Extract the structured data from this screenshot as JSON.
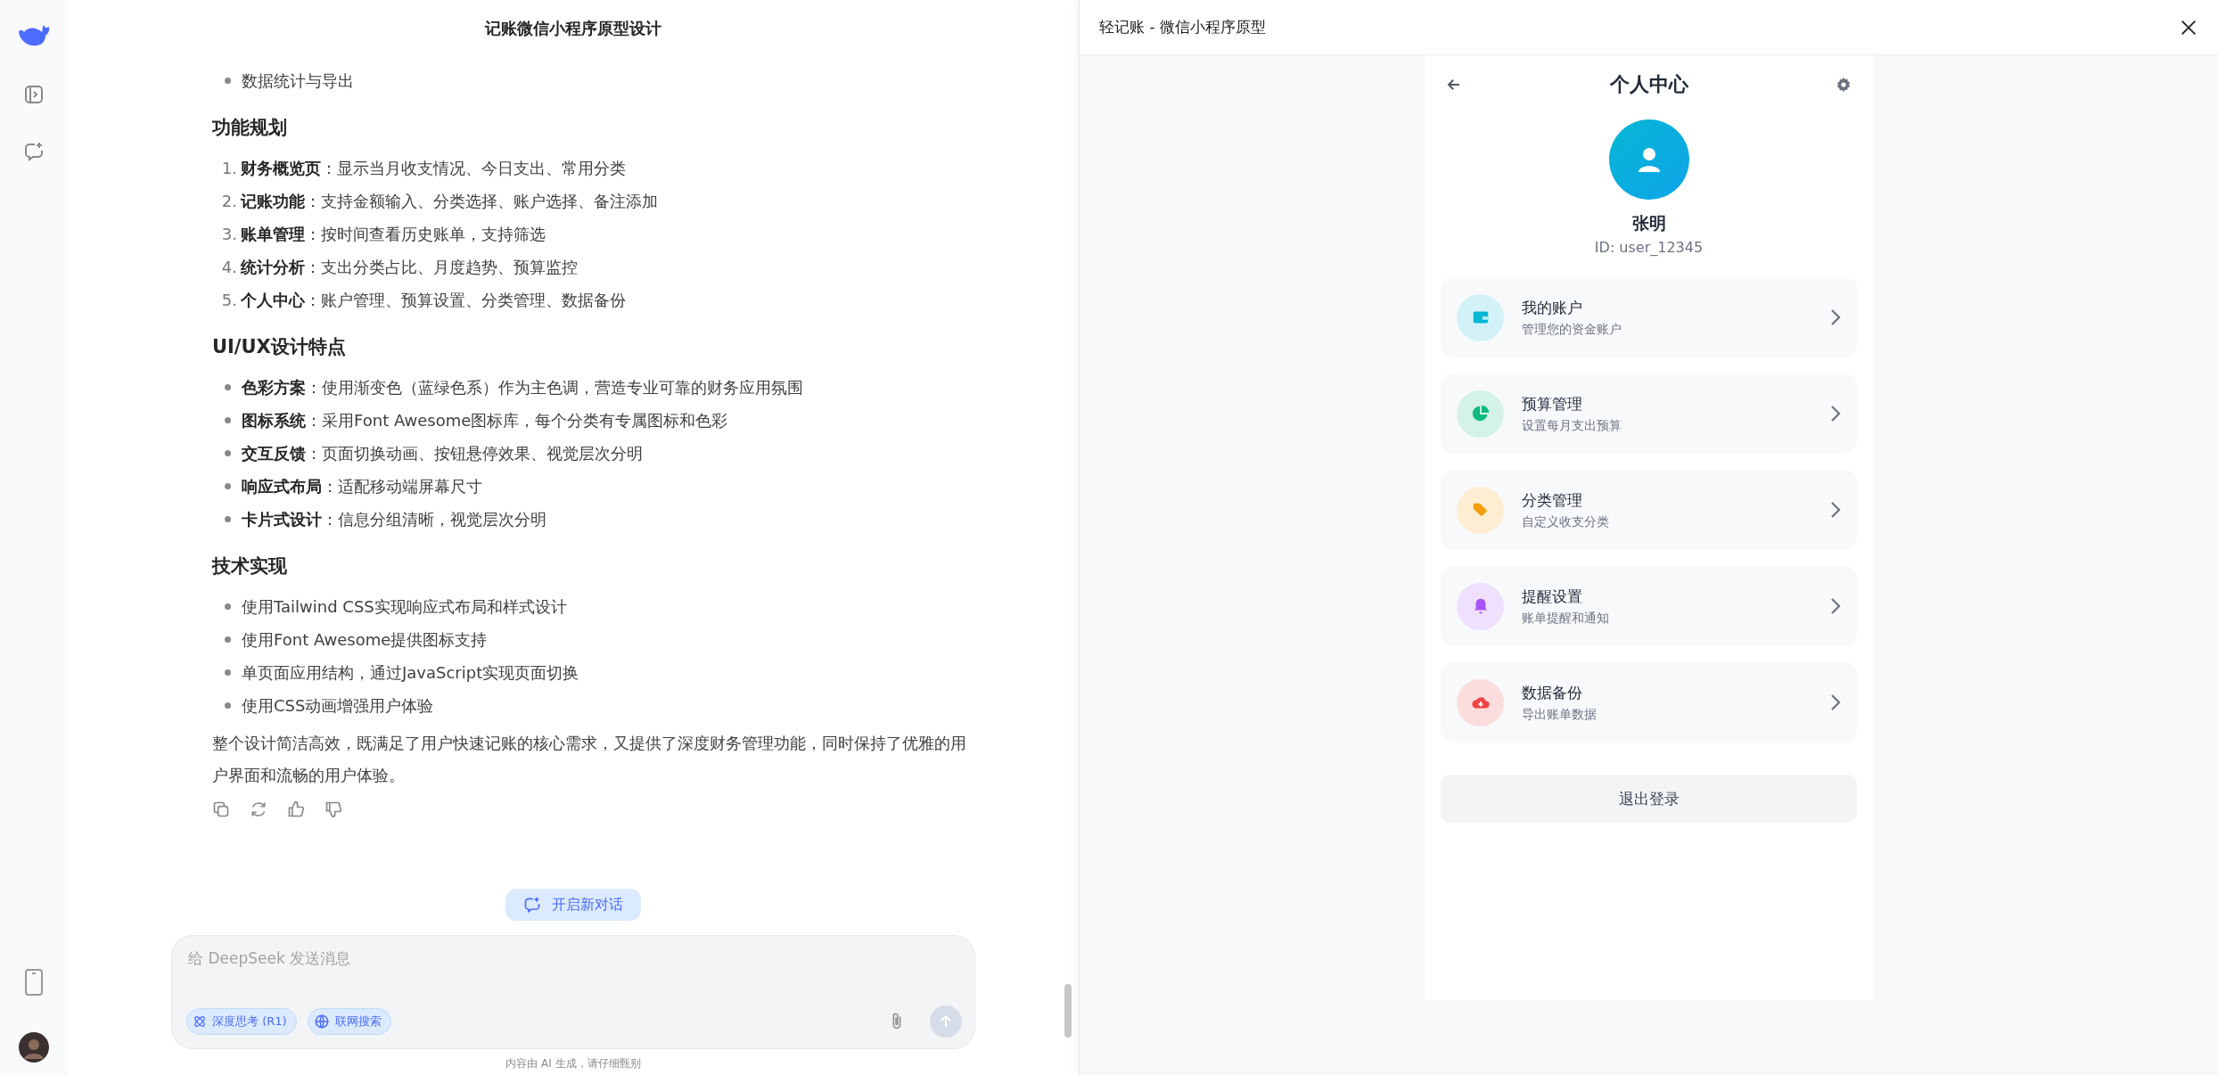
{
  "chat": {
    "title": "记账微信小程序原型设计",
    "blocks": [
      {
        "kind": "bullets",
        "items": [
          "数据统计与导出"
        ]
      },
      {
        "kind": "heading",
        "text": "功能规划"
      },
      {
        "kind": "ordered",
        "items": [
          {
            "number": "1.",
            "text": "**财务概览页**：显示当月收支情况、今日支出、常用分类"
          },
          {
            "number": "2.",
            "text": "**记账功能**：支持金额输入、分类选择、账户选择、备注添加"
          },
          {
            "number": "3.",
            "text": "**账单管理**：按时间查看历史账单，支持筛选"
          },
          {
            "number": "4.",
            "text": "**统计分析**：支出分类占比、月度趋势、预算监控"
          },
          {
            "number": "5.",
            "text": "**个人中心**：账户管理、预算设置、分类管理、数据备份"
          }
        ]
      },
      {
        "kind": "heading",
        "text": "UI/UX设计特点"
      },
      {
        "kind": "bullets",
        "items": [
          "**色彩方案**：使用渐变色（蓝绿色系）作为主色调，营造专业可靠的财务应用氛围",
          "**图标系统**：采用Font Awesome图标库，每个分类有专属图标和色彩",
          "**交互反馈**：页面切换动画、按钮悬停效果、视觉层次分明",
          "**响应式布局**：适配移动端屏幕尺寸",
          "**卡片式设计**：信息分组清晰，视觉层次分明"
        ]
      },
      {
        "kind": "heading",
        "text": "技术实现"
      },
      {
        "kind": "bullets",
        "items": [
          "使用Tailwind CSS实现响应式布局和样式设计",
          "使用Font Awesome提供图标支持",
          "单页面应用结构，通过JavaScript实现页面切换",
          "使用CSS动画增强用户体验"
        ]
      },
      {
        "kind": "paragraph",
        "text": "整个设计简洁高效，既满足了用户快速记账的核心需求，又提供了深度财务管理功能，同时保持了优雅的用户界面和流畅的用户体验。"
      }
    ],
    "new_chat": "开启新对话",
    "input": {
      "placeholder": "给 DeepSeek 发送消息",
      "toggles": [
        {
          "label": "深度思考 (R1)",
          "kind": "think",
          "selected": true
        },
        {
          "label": "联网搜索",
          "kind": "web",
          "selected": true
        }
      ]
    },
    "disclaimer": "内容由 AI 生成，请仔细甄别"
  },
  "preview": {
    "title": "轻记账 - 微信小程序原型",
    "page_title": "个人中心",
    "user": {
      "name": "张明",
      "id": "ID: user_12345"
    },
    "menu": [
      {
        "title": "我的账户",
        "subtitle": "管理您的资金账户",
        "kind": "wallet",
        "color": "#06b6d4"
      },
      {
        "title": "预算管理",
        "subtitle": "设置每月支出预算",
        "kind": "pie",
        "color": "#10b981"
      },
      {
        "title": "分类管理",
        "subtitle": "自定义收支分类",
        "kind": "tag",
        "color": "#f59e0b"
      },
      {
        "title": "提醒设置",
        "subtitle": "账单提醒和通知",
        "kind": "bell",
        "color": "#a855f7"
      },
      {
        "title": "数据备份",
        "subtitle": "导出账单数据",
        "kind": "cloud",
        "color": "#ef4444"
      }
    ],
    "logout": "退出登录"
  }
}
